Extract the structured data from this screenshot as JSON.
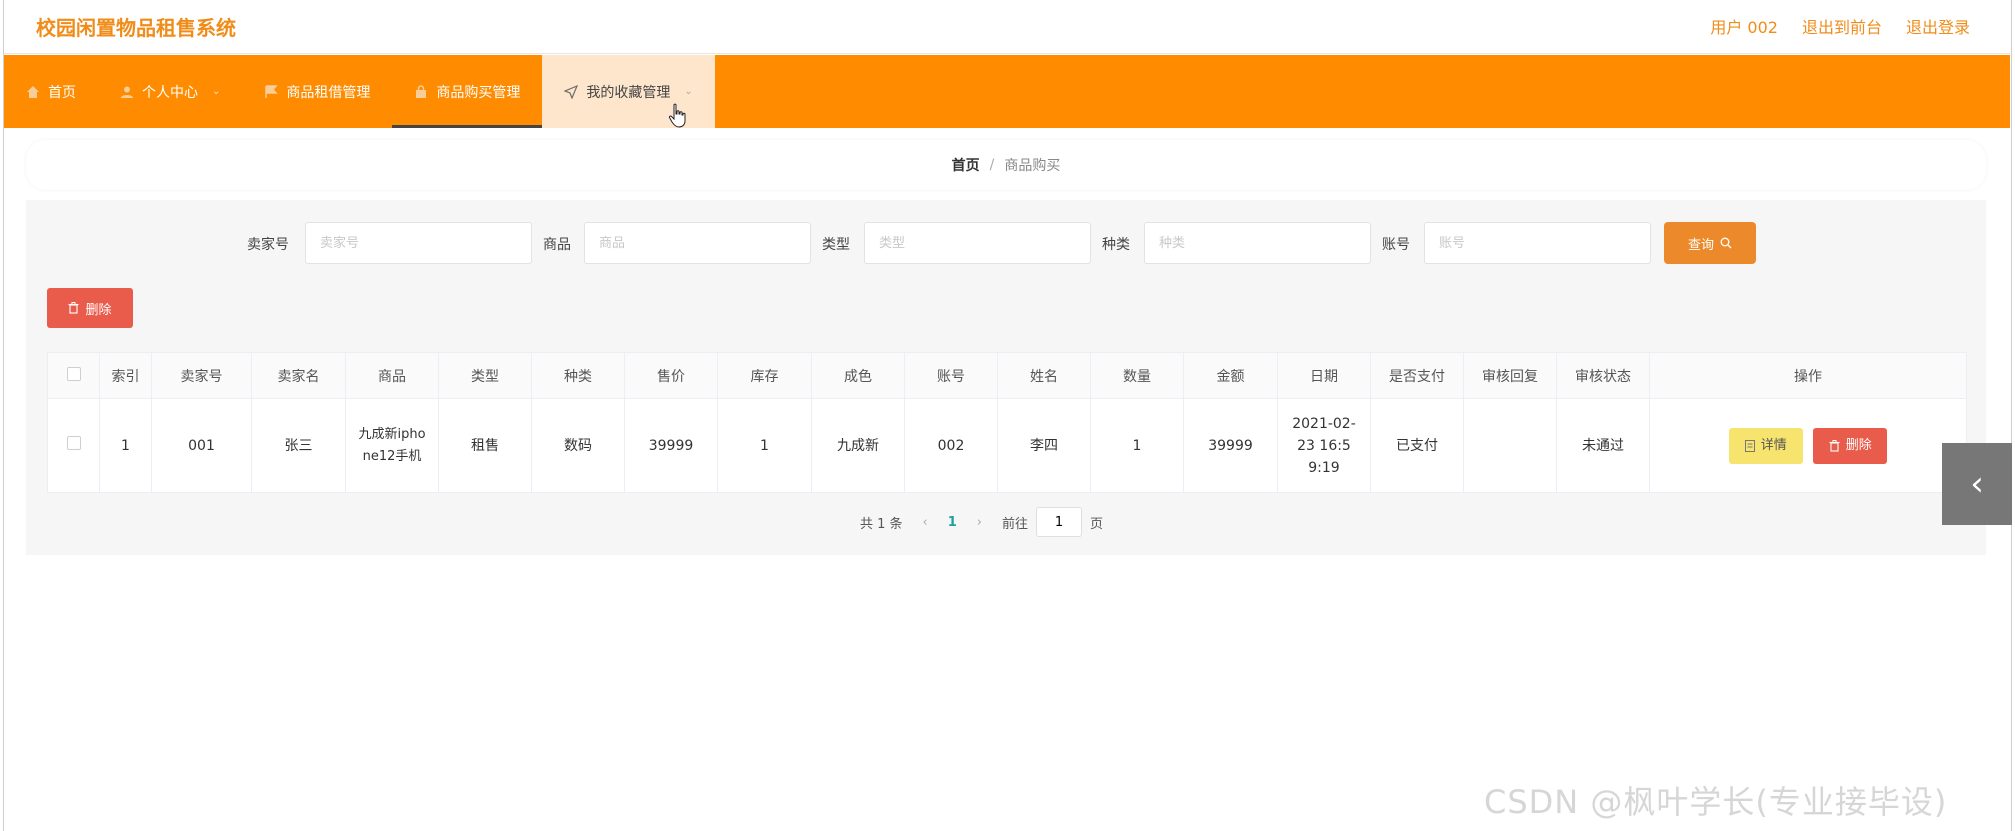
{
  "header": {
    "app_title": "校园闲置物品租售系统",
    "user_label": "用户 002",
    "back_front": "退出到前台",
    "logout": "退出登录"
  },
  "nav": {
    "items": [
      {
        "label": "首页",
        "icon": "home-icon"
      },
      {
        "label": "个人中心",
        "icon": "user-icon"
      },
      {
        "label": "商品租借管理",
        "icon": "flag-icon"
      },
      {
        "label": "商品购买管理",
        "icon": "bag-icon"
      },
      {
        "label": "我的收藏管理",
        "icon": "send-icon"
      }
    ]
  },
  "breadcrumb": {
    "home": "首页",
    "separator": "/",
    "current": "商品购买"
  },
  "search": {
    "fields": [
      {
        "label": "卖家号",
        "placeholder": "卖家号"
      },
      {
        "label": "商品",
        "placeholder": "商品"
      },
      {
        "label": "类型",
        "placeholder": "类型"
      },
      {
        "label": "种类",
        "placeholder": "种类"
      },
      {
        "label": "账号",
        "placeholder": "账号"
      }
    ],
    "query_button": "查询"
  },
  "toolbar": {
    "delete_label": "删除"
  },
  "table": {
    "headers": [
      "索引",
      "卖家号",
      "卖家名",
      "商品",
      "类型",
      "种类",
      "售价",
      "库存",
      "成色",
      "账号",
      "姓名",
      "数量",
      "金额",
      "日期",
      "是否支付",
      "审核回复",
      "审核状态",
      "操作"
    ],
    "rows": [
      {
        "index": "1",
        "seller_no": "001",
        "seller_name": "张三",
        "product": "九成新iphone12手机",
        "type": "租售",
        "category": "数码",
        "price": "39999",
        "stock": "1",
        "condition": "九成新",
        "account": "002",
        "name": "李四",
        "quantity": "1",
        "amount": "39999",
        "date": "2021-02-23 16:59:19",
        "paid": "已支付",
        "review_reply": "",
        "review_status": "未通过",
        "detail_label": "详情",
        "delete_label": "删除"
      }
    ]
  },
  "pagination": {
    "total": "共 1 条",
    "current_page": "1",
    "goto_prefix": "前往",
    "goto_value": "1",
    "goto_suffix": "页"
  },
  "watermark": "CSDN @枫叶学长(专业接毕设)",
  "colors": {
    "accent": "#ff8c00",
    "title": "#f08c1a",
    "danger": "#e95c4b",
    "warning": "#f6e46e"
  }
}
